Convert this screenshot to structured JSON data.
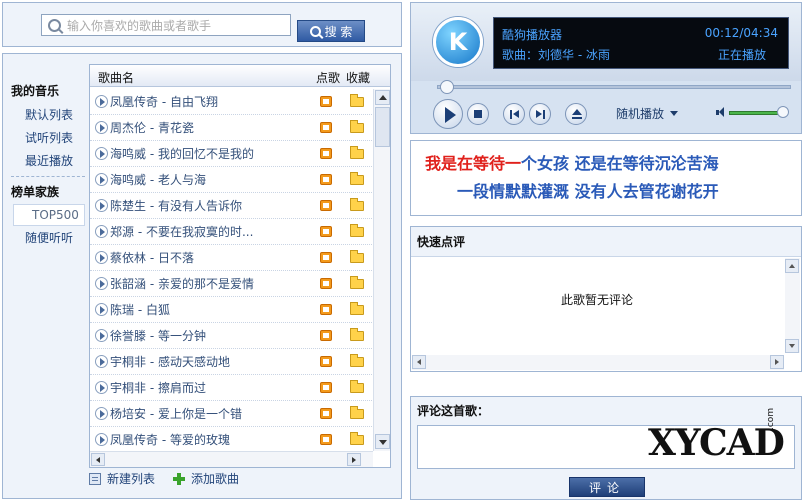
{
  "search": {
    "placeholder": "输入你喜欢的歌曲或者歌手",
    "button_label": "搜 索"
  },
  "sidebar": {
    "my_music_heading": "我的音乐",
    "my_music_items": [
      "默认列表",
      "试听列表",
      "最近播放"
    ],
    "charts_heading": "榜单家族",
    "charts_items": [
      {
        "label": "TOP500",
        "active": true
      },
      {
        "label": "随便听听",
        "active": false
      }
    ]
  },
  "song_list": {
    "columns": {
      "name": "歌曲名",
      "pick": "点歌",
      "favorite": "收藏"
    },
    "rows": [
      "凤凰传奇 - 自由飞翔",
      "周杰伦 - 青花瓷",
      "海鸣威 - 我的回忆不是我的",
      "海鸣威 - 老人与海",
      "陈楚生 - 有没有人告诉你",
      "郑源 - 不要在我寂寞的时...",
      "蔡依林 - 日不落",
      "张韶涵 - 亲爱的那不是爱情",
      "陈瑞 - 白狐",
      "徐誉滕 - 等一分钟",
      "宇桐非 - 感动天感动地",
      "宇桐非 - 擦肩而过",
      "杨培安 - 爱上你是一个错",
      "凤凰传奇 - 等爱的玫瑰"
    ],
    "new_list_label": "新建列表",
    "add_song_label": "添加歌曲"
  },
  "player": {
    "logo_letter": "K",
    "app_name": "酷狗播放器",
    "song_label": "歌曲：刘德华 - 冰雨",
    "time": "00:12/04:34",
    "status": "正在播放",
    "mode": "随机播放",
    "progress_fraction": 0.03,
    "volume_fraction": 0.85
  },
  "lyrics": {
    "line1_sung": "我是在等待一",
    "line1_rest": "个女孩  还是在等待沉沦苦海",
    "line2": "一段情默默灌溉  没有人去管花谢花开"
  },
  "quick_review": {
    "title": "快速点评",
    "empty_text": "此歌暂无评论"
  },
  "comment": {
    "label": "评论这首歌：",
    "submit_label": "评论"
  },
  "watermark": {
    "text": "XYCAD",
    "suffix": ".com"
  },
  "colors": {
    "panel_border": "#9fb5d3",
    "panel_bg": "#eef3fa",
    "lyric_sung": "#e0211c",
    "lyric_unsung": "#2a5ab8",
    "screen_text": "#4aa3ff"
  }
}
